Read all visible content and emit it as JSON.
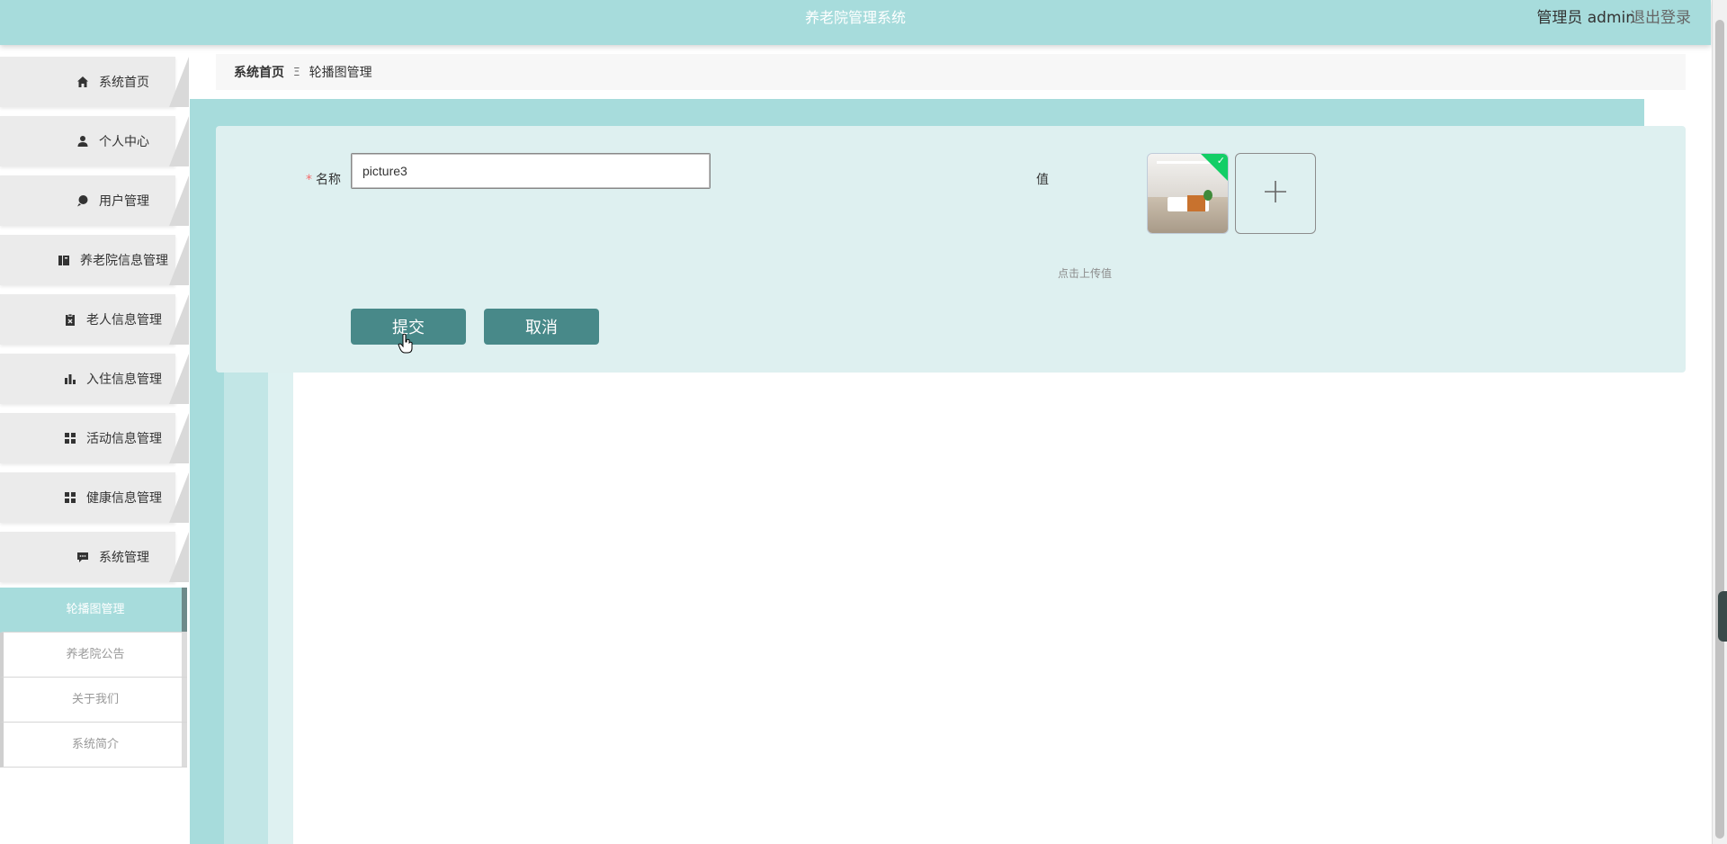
{
  "header": {
    "title": "养老院管理系统",
    "user": "管理员 admin",
    "logout": "退出登录"
  },
  "sidebar": {
    "items": [
      {
        "label": "系统首页",
        "icon": "home-icon"
      },
      {
        "label": "个人中心",
        "icon": "user-icon"
      },
      {
        "label": "用户管理",
        "icon": "pin-icon"
      },
      {
        "label": "养老院信息管理",
        "icon": "book-icon"
      },
      {
        "label": "老人信息管理",
        "icon": "clipboard-icon"
      },
      {
        "label": "入住信息管理",
        "icon": "bar-chart-icon"
      },
      {
        "label": "活动信息管理",
        "icon": "grid-icon"
      },
      {
        "label": "健康信息管理",
        "icon": "grid-icon"
      },
      {
        "label": "系统管理",
        "icon": "chat-icon"
      }
    ],
    "submenu": [
      {
        "label": "轮播图管理",
        "active": true
      },
      {
        "label": "养老院公告",
        "active": false
      },
      {
        "label": "关于我们",
        "active": false
      },
      {
        "label": "系统简介",
        "active": false
      }
    ]
  },
  "breadcrumb": {
    "home": "系统首页",
    "separator": "Ξ",
    "current": "轮播图管理"
  },
  "form": {
    "name_label": "名称",
    "required_mark": "*",
    "name_value": "picture3",
    "value_label": "值",
    "upload_hint": "点击上传值",
    "submit": "提交",
    "cancel": "取消"
  },
  "colors": {
    "accent": "#a7dcdc",
    "button": "#488989",
    "panel": "#def0f0",
    "success_corner": "#13ce66"
  }
}
